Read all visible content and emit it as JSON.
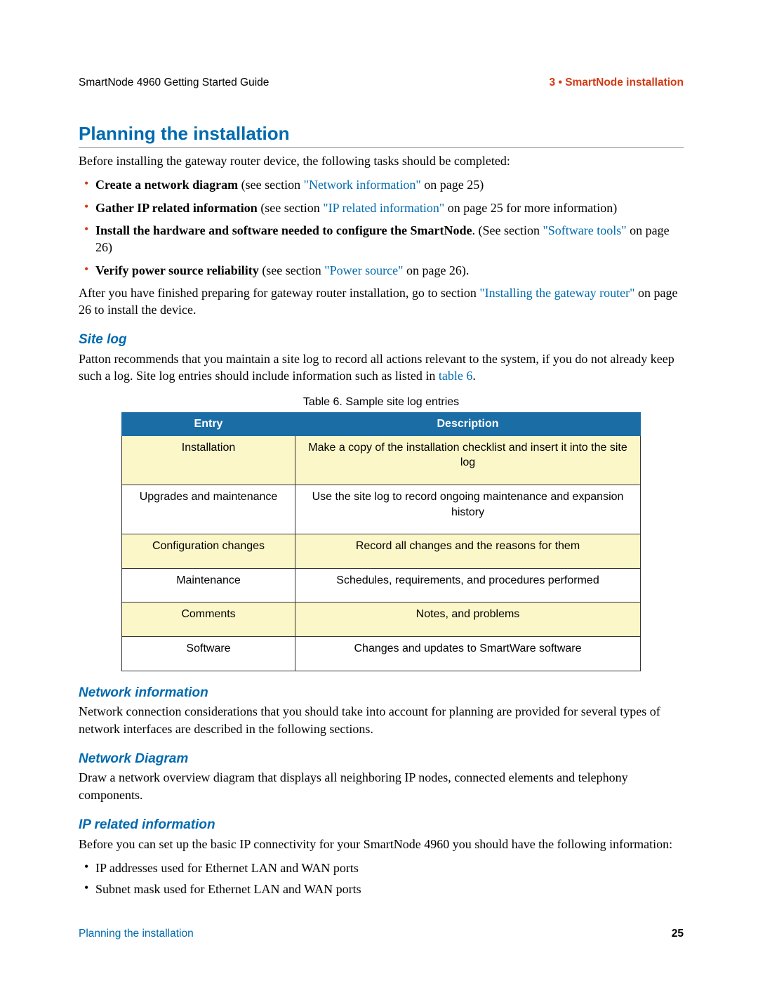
{
  "header": {
    "left": "SmartNode 4960 Getting Started Guide",
    "right": "3 • SmartNode installation"
  },
  "title": "Planning the installation",
  "intro": "Before installing the gateway router device, the following tasks should be completed:",
  "bullets": [
    {
      "bold": "Create a network diagram",
      "mid": " (see section ",
      "link": "\"Network information\"",
      "tail": " on page 25)"
    },
    {
      "bold": "Gather IP related information",
      "mid": " (see section ",
      "link": "\"IP related information\"",
      "tail": " on page 25 for more information)"
    },
    {
      "bold": "Install the hardware and software needed to configure the SmartNode",
      "mid": ". (See section ",
      "link": "\"Software tools\"",
      "tail": " on page 26)"
    },
    {
      "bold": "Verify power source reliability",
      "mid": " (see section ",
      "link": "\"Power source\"",
      "tail": " on page 26)."
    }
  ],
  "after_pre": "After you have finished preparing for gateway router installation, go to section ",
  "after_link": "\"Installing the gateway router\"",
  "after_post": " on page 26 to install the device.",
  "sitelog": {
    "heading": "Site log",
    "body_pre": "Patton recommends that you maintain a site log to record all actions relevant to the system, if you do not already keep such a log. Site log entries should include information such as listed in ",
    "body_link": "table 6",
    "body_post": ".",
    "caption": "Table 6. Sample site log entries",
    "cols": [
      "Entry",
      "Description"
    ],
    "rows": [
      [
        "Installation",
        "Make a copy of the installation checklist and insert it into the site log"
      ],
      [
        "Upgrades and maintenance",
        "Use the site log to record ongoing maintenance and expansion history"
      ],
      [
        "Configuration changes",
        "Record all changes and the reasons for them"
      ],
      [
        "Maintenance",
        "Schedules, requirements, and procedures performed"
      ],
      [
        "Comments",
        "Notes, and problems"
      ],
      [
        "Software",
        "Changes and updates to SmartWare software"
      ]
    ]
  },
  "netinfo": {
    "heading": "Network information",
    "body": "Network connection considerations that you should take into account for planning are provided for several types of network interfaces are described in the following sections."
  },
  "netdiag": {
    "heading": "Network Diagram",
    "body": "Draw a network overview diagram that displays all neighboring IP nodes, connected elements and telephony components."
  },
  "ipinfo": {
    "heading": "IP related information",
    "body": "Before you can set up the basic IP connectivity for your SmartNode 4960 you should have the following information:",
    "items": [
      "IP addresses used for Ethernet LAN and WAN ports",
      "Subnet mask used for Ethernet LAN and WAN ports"
    ]
  },
  "footer": {
    "left": "Planning the installation",
    "right": "25"
  }
}
